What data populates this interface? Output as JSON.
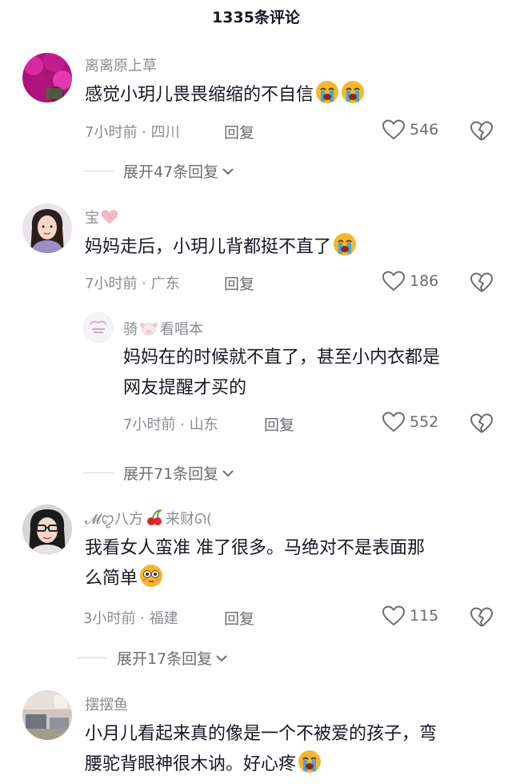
{
  "header": {
    "title": "1335条评论"
  },
  "comments": [
    {
      "username": "离离原上草",
      "text": "感觉小玥儿畏畏缩缩的不自信",
      "time": "7小时前",
      "location": "四川",
      "reply_label": "回复",
      "likes": "546",
      "expand_label": "展开47条回复"
    },
    {
      "username": "宝",
      "text": "妈妈走后，小玥儿背都挺不直了",
      "time": "7小时前",
      "location": "广东",
      "reply_label": "回复",
      "likes": "186"
    },
    {
      "username_a": "骑",
      "username_b": "看唱本",
      "text_line1": "妈妈在的时候就不直了，甚至小内衣都是",
      "text_line2": "网友提醒才买的",
      "time": "7小时前",
      "location": "山东",
      "reply_label": "回复",
      "likes": "552",
      "expand_label": "展开71条回复"
    },
    {
      "username_a": "𝓜ꨄ八方",
      "username_b": "来财ᘏ(",
      "text_line1": "我看女人蛮准 准了很多。马绝对不是表面那",
      "text_line2": "么简单",
      "time": "3小时前",
      "location": "福建",
      "reply_label": "回复",
      "likes": "115",
      "expand_label": "展开17条回复"
    },
    {
      "username": "摆摆鱼",
      "text_line1": "小月儿看起来真的像是一个不被爱的孩子，弯",
      "text_line2": "腰驼背眼神很木讷。好心疼"
    }
  ],
  "meta_separator": " · ",
  "icons": {
    "like": "heart-outline-icon",
    "dislike": "broken-heart-icon",
    "expand": "chevron-down-icon",
    "crying": "loudly-crying-emoji",
    "flushed": "flushed-face-emoji"
  },
  "colors": {
    "text": "#161823",
    "muted": "#8a8b91",
    "action": "#6b6c72",
    "emoji": "#f5b72a",
    "tear": "#4aa3e0",
    "pink_heart": "#f7b6c2"
  }
}
